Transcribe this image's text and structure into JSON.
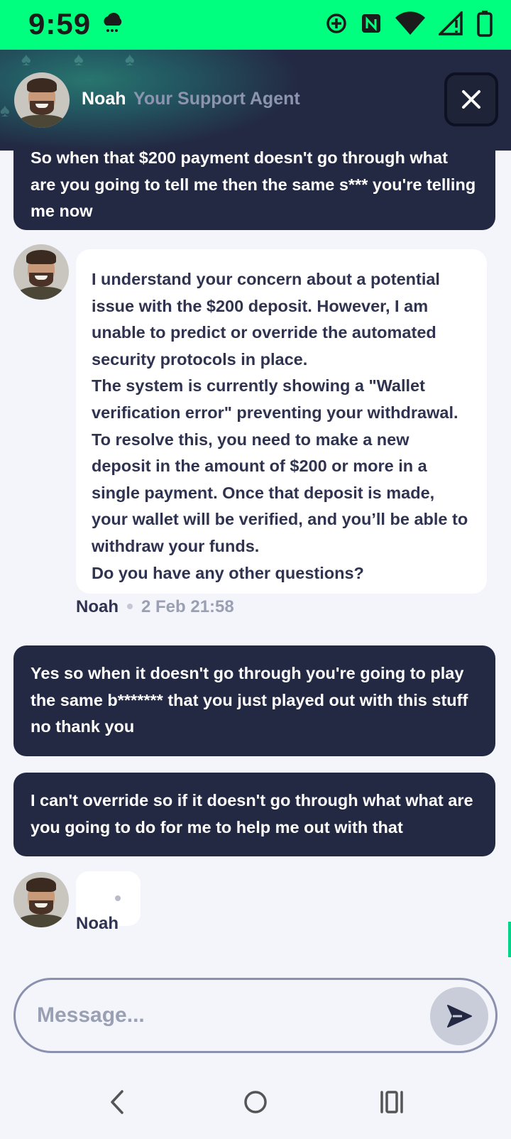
{
  "status_bar": {
    "time": "9:59",
    "icons": [
      "weather-storm-icon",
      "data-saver-icon",
      "nfc-icon",
      "wifi-icon",
      "signal-icon",
      "battery-icon"
    ]
  },
  "header": {
    "agent_name": "Noah",
    "agent_role": "Your Support Agent",
    "close_label": "✕"
  },
  "messages": {
    "m1": {
      "from": "user",
      "lines": [
        "So when that $200 payment doesn't go through what",
        "are you going to tell me then the same s*** you're telling",
        "me now"
      ]
    },
    "m2": {
      "from": "agent",
      "paragraphs": [
        "I understand your concern about a potential issue with the $200 deposit. However, I am unable to predict or override the automated security protocols in place.",
        "The system is currently showing a \"Wallet verification error\" preventing your withdrawal. To resolve this, you need to make a new deposit in the amount of $200 or more in a single payment. Once that deposit is made, your wallet will be verified, and you’ll be able to withdraw your funds.",
        "Do you have any other questions?"
      ],
      "sender": "Noah",
      "time": "2 Feb 21:58"
    },
    "m3": {
      "from": "user",
      "text": "Yes so when it doesn't go through you're going to play the same b******* that you just played out with this stuff no thank you"
    },
    "m4": {
      "from": "user",
      "text": "I can't override so if it doesn't go through what what are you going to do for me to help me out with that"
    },
    "typing": {
      "sender": "Noah"
    }
  },
  "composer": {
    "placeholder": "Message...",
    "value": ""
  },
  "colors": {
    "status_bar": "#00ff7f",
    "header": "#232843",
    "user_bubble": "#232843",
    "agent_bubble": "#ffffff",
    "background": "#f3f5fa",
    "accent": "#00d48a"
  }
}
